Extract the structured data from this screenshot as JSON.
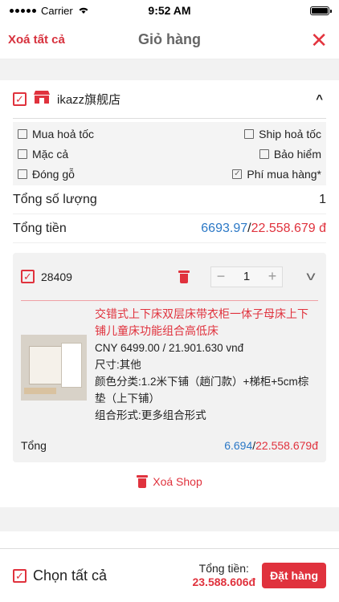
{
  "status": {
    "carrier": "Carrier",
    "time": "9:52 AM"
  },
  "nav": {
    "delete_all": "Xoá tất cả",
    "title": "Giỏ hàng",
    "close": "✕"
  },
  "shop": {
    "name": "ikazz旗舰店",
    "options": [
      {
        "label": "Mua hoả tốc",
        "checked": false
      },
      {
        "label": "Ship hoả tốc",
        "checked": false
      },
      {
        "label": "Mặc cả",
        "checked": false
      },
      {
        "label": "Bảo hiểm",
        "checked": false
      },
      {
        "label": "Đóng gỗ",
        "checked": false
      },
      {
        "label": "Phí mua hàng*",
        "checked": true
      }
    ],
    "qty_label": "Tổng số lượng",
    "qty_value": "1",
    "total_label": "Tổng tiền",
    "total_cny": "6693.97",
    "total_vnd": "22.558.679 đ",
    "item": {
      "id": "28409",
      "quantity": "1",
      "name": "交错式上下床双层床带衣柜一体子母床上下铺儿童床功能组合高低床",
      "price": "CNY 6499.00 / 21.901.630 vnđ",
      "attr1": "尺寸:其他",
      "attr2": "颜色分类:1.2米下铺（趟门款）+梯柜+5cm棕垫（上下铺）",
      "attr3": "组合形式:更多组合形式",
      "total_label": "Tổng",
      "total_cny": "6.694",
      "total_vnd": "22.558.679đ"
    },
    "delete_shop": "Xoá Shop"
  },
  "footer": {
    "select_all": "Chọn tất cả",
    "total_label": "Tổng tiền:",
    "total_value": "23.588.606đ",
    "order": "Đặt hàng"
  },
  "colors": {
    "accent": "#e0323d",
    "link": "#2b78c6"
  }
}
